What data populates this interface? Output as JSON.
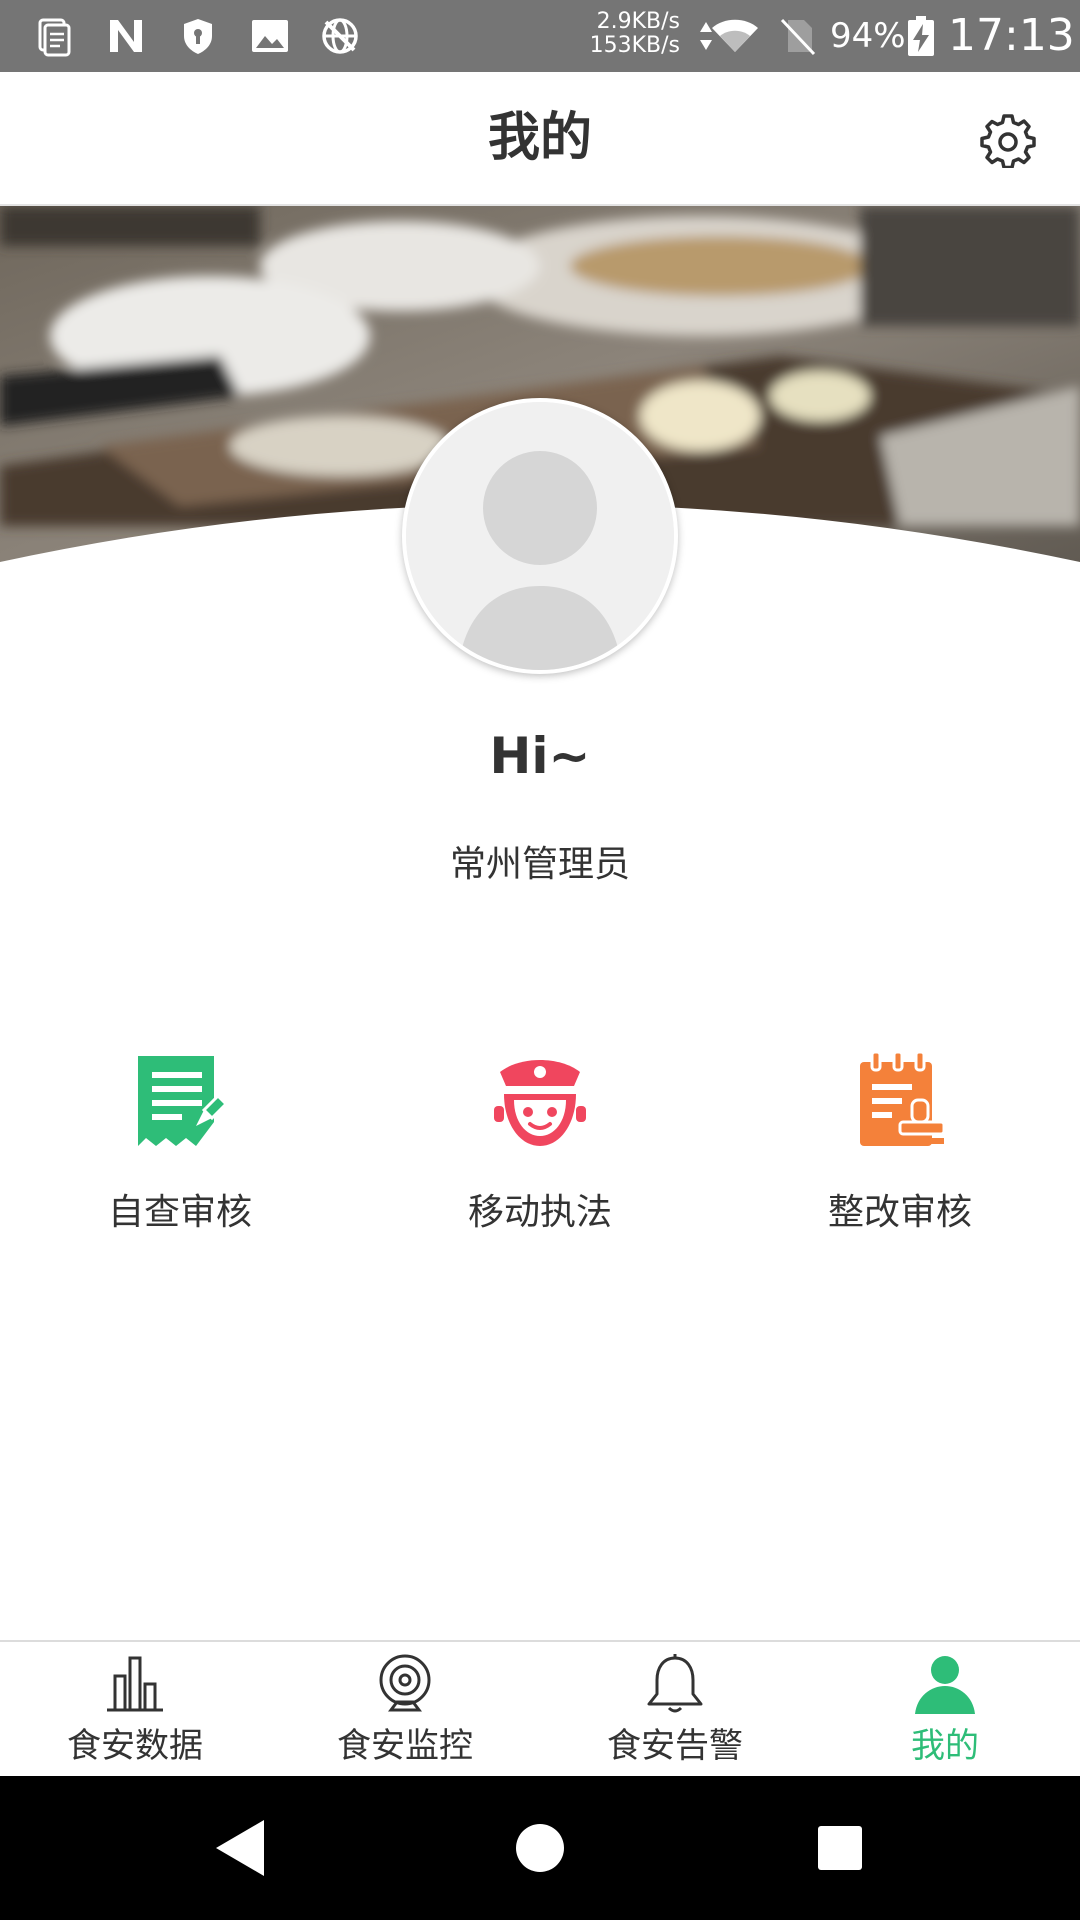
{
  "status_bar": {
    "speed_up": "2.9KB/s",
    "speed_down": "153KB/s",
    "battery": "94%",
    "time": "17:13"
  },
  "header": {
    "title": "我的",
    "settings_icon": "gear-icon"
  },
  "profile": {
    "greeting": "Hi~",
    "role": "常州管理员"
  },
  "features": [
    {
      "label": "自查审核",
      "icon": "self-check-doc-icon",
      "color": "#2ebd78"
    },
    {
      "label": "移动执法",
      "icon": "police-officer-icon",
      "color": "#f0465e"
    },
    {
      "label": "整改审核",
      "icon": "rectify-stamp-icon",
      "color": "#f4813a"
    }
  ],
  "bottom_nav": [
    {
      "label": "食安数据",
      "icon": "bar-chart-icon",
      "active": false
    },
    {
      "label": "食安监控",
      "icon": "webcam-icon",
      "active": false
    },
    {
      "label": "食安告警",
      "icon": "bell-icon",
      "active": false
    },
    {
      "label": "我的",
      "icon": "user-icon",
      "active": true
    }
  ],
  "colors": {
    "accent": "#2ebd78",
    "status_bar": "#757575",
    "text": "#333333"
  }
}
